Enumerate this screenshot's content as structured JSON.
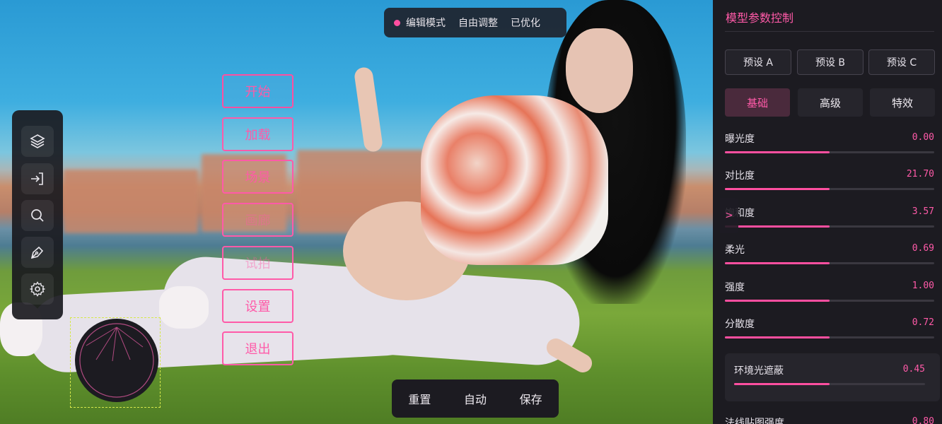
{
  "mode_bar": {
    "items": [
      "编辑模式",
      "自由调整",
      "已优化"
    ],
    "dot_color": "#ff4fa0"
  },
  "toolbar": {
    "icons": [
      "layers-icon",
      "login-icon",
      "search-icon",
      "pen-tool-icon",
      "settings-icon"
    ]
  },
  "menu": {
    "items": [
      "开始",
      "加载",
      "场景",
      "画廊",
      "试拍",
      "设置",
      "退出"
    ]
  },
  "actions": {
    "reset": "重置",
    "auto": "自动",
    "save": "保存"
  },
  "panel": {
    "title": "模型参数控制",
    "presets": [
      "预设 A",
      "预设 B",
      "预设 C"
    ],
    "tabs": [
      "基础",
      "高级",
      "特效"
    ],
    "active_tab": "基础",
    "collapse_label": ">",
    "params": [
      {
        "label": "曝光度",
        "value": "0.00",
        "level": 0.5
      },
      {
        "label": "对比度",
        "value": "21.70",
        "level": 0.5
      },
      {
        "label": "饱和度",
        "value": "3.57",
        "level": 0.5
      },
      {
        "label": "柔光",
        "value": "0.69",
        "level": 0.5
      },
      {
        "label": "强度",
        "value": "1.00",
        "level": 0.5
      },
      {
        "label": "分散度",
        "value": "0.72",
        "level": 0.5
      }
    ],
    "ambient": {
      "label": "环境光遮蔽",
      "value": "0.45",
      "level": 0.5
    },
    "normal_map": {
      "label": "法线贴图强度",
      "value": "0.80"
    }
  },
  "colors": {
    "accent": "#ff4fa0",
    "panel_bg": "#1c1b21"
  }
}
